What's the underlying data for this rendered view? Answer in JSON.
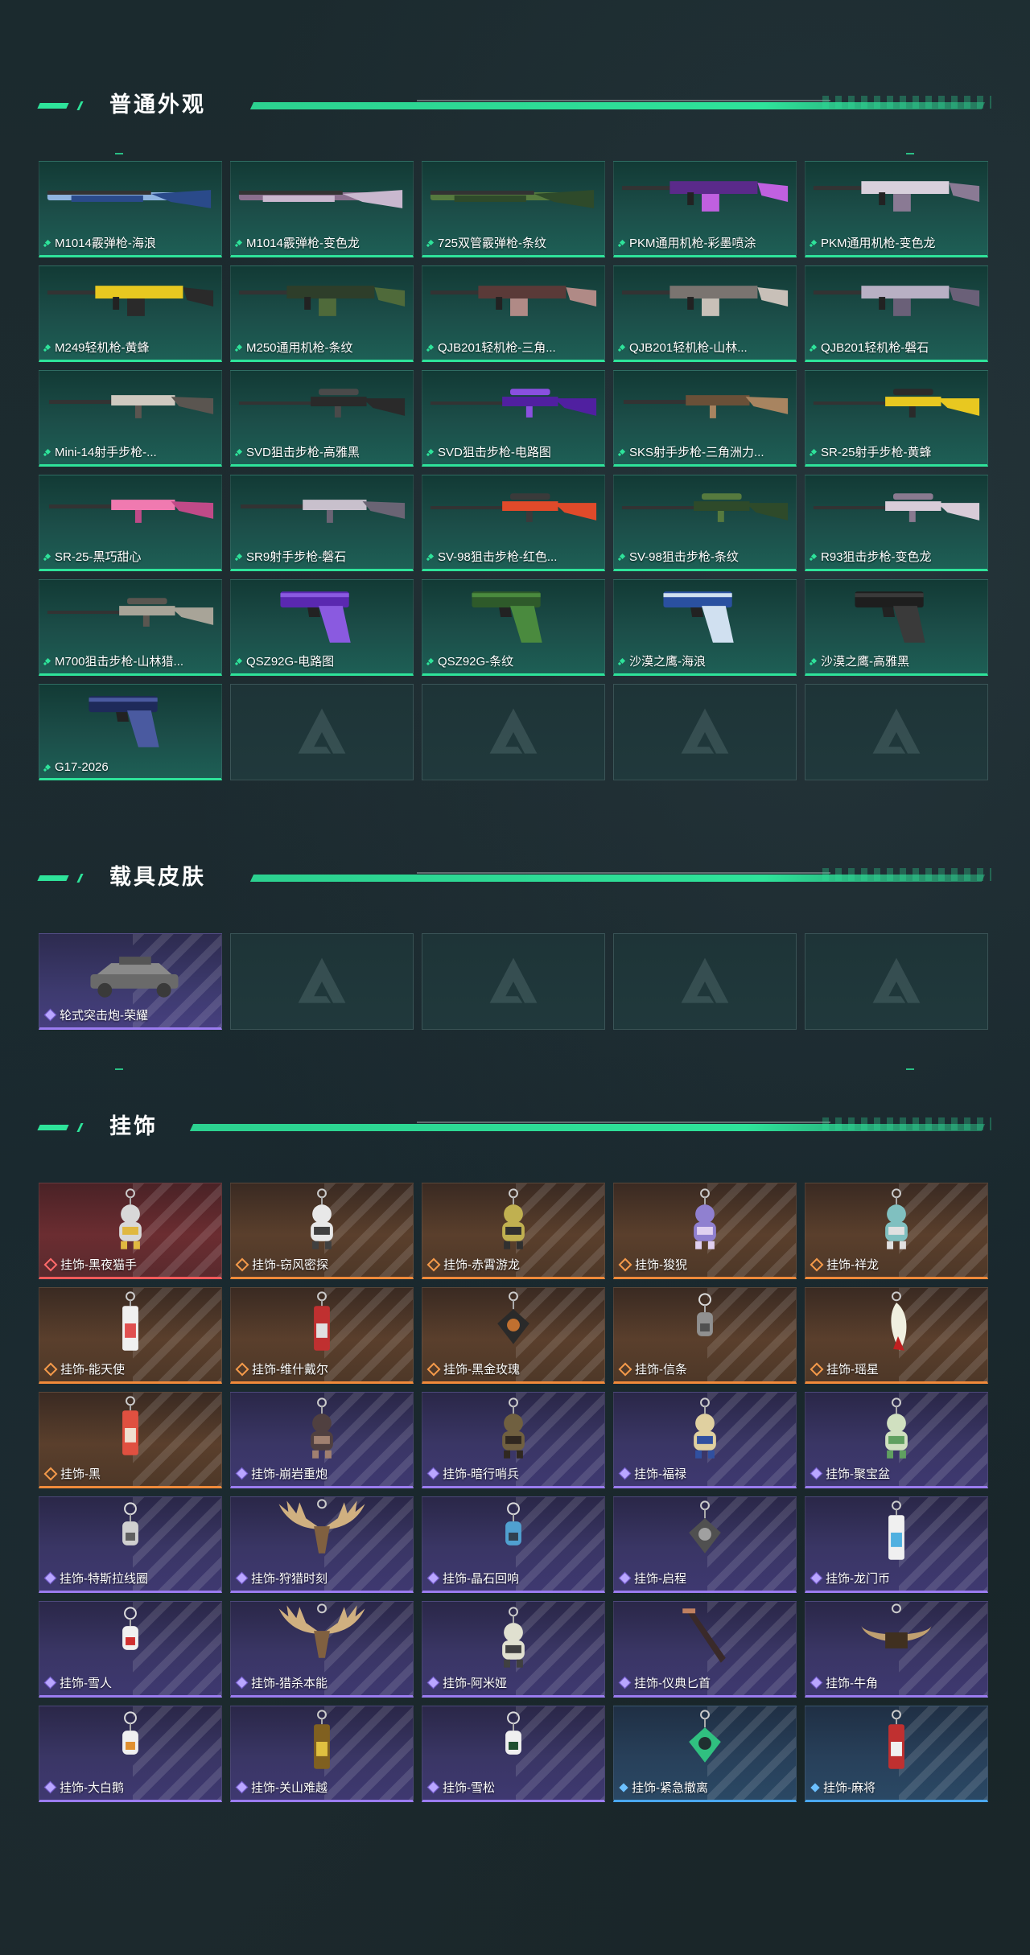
{
  "sections": {
    "skins": {
      "title": "普通外观",
      "items": [
        {
          "name": "M1014霰弹枪-海浪",
          "rarity": "green",
          "art": "shotgun",
          "colors": [
            "#2a4a8a",
            "#8fb4e0"
          ]
        },
        {
          "name": "M1014霰弹枪-变色龙",
          "rarity": "green",
          "art": "shotgun",
          "colors": [
            "#c9b8cf",
            "#8a6f8e"
          ]
        },
        {
          "name": "725双管霰弹枪-条纹",
          "rarity": "green",
          "art": "shotgun",
          "colors": [
            "#2e4a2a",
            "#567a3e"
          ]
        },
        {
          "name": "PKM通用机枪-彩墨喷涂",
          "rarity": "green",
          "art": "mg",
          "colors": [
            "#5a2a8a",
            "#c060e0"
          ]
        },
        {
          "name": "PKM通用机枪-变色龙",
          "rarity": "green",
          "art": "mg",
          "colors": [
            "#d8d0dc",
            "#8a7a94"
          ]
        },
        {
          "name": "M249轻机枪-黄蜂",
          "rarity": "green",
          "art": "mg",
          "colors": [
            "#e8c820",
            "#2a2a2a"
          ]
        },
        {
          "name": "M250通用机枪-条纹",
          "rarity": "green",
          "art": "mg",
          "colors": [
            "#2e3e2a",
            "#4f6a3a"
          ]
        },
        {
          "name": "QJB201轻机枪-三角...",
          "rarity": "green",
          "art": "mg",
          "colors": [
            "#5a3a38",
            "#b08a86"
          ]
        },
        {
          "name": "QJB201轻机枪-山林...",
          "rarity": "green",
          "art": "mg",
          "colors": [
            "#7a7470",
            "#c8c0b8"
          ]
        },
        {
          "name": "QJB201轻机枪-磐石",
          "rarity": "green",
          "art": "mg",
          "colors": [
            "#b8b0c4",
            "#6a6078"
          ]
        },
        {
          "name": "Mini-14射手步枪-...",
          "rarity": "green",
          "art": "rifle",
          "colors": [
            "#cfc9c0",
            "#5a5550"
          ]
        },
        {
          "name": "SVD狙击步枪-高雅黑",
          "rarity": "green",
          "art": "sniper",
          "colors": [
            "#2a2a2a",
            "#4a4a4a"
          ]
        },
        {
          "name": "SVD狙击步枪-电路图",
          "rarity": "green",
          "art": "sniper",
          "colors": [
            "#5020a0",
            "#8a50e0"
          ]
        },
        {
          "name": "SKS射手步枪-三角洲力...",
          "rarity": "green",
          "art": "rifle",
          "colors": [
            "#6a5038",
            "#a88460"
          ]
        },
        {
          "name": "SR-25射手步枪-黄蜂",
          "rarity": "green",
          "art": "sniper",
          "colors": [
            "#e8c820",
            "#2a2a2a"
          ]
        },
        {
          "name": "SR-25-黑巧甜心",
          "rarity": "green",
          "art": "rifle",
          "colors": [
            "#f07ab0",
            "#c04a88"
          ]
        },
        {
          "name": "SR9射手步枪-磐石",
          "rarity": "green",
          "art": "rifle",
          "colors": [
            "#c8c0cc",
            "#6a6474"
          ]
        },
        {
          "name": "SV-98狙击步枪-红色...",
          "rarity": "green",
          "art": "sniper",
          "colors": [
            "#e04a2a",
            "#3a3a3a"
          ]
        },
        {
          "name": "SV-98狙击步枪-条纹",
          "rarity": "green",
          "art": "sniper",
          "colors": [
            "#2e4a2a",
            "#567a3e"
          ]
        },
        {
          "name": "R93狙击步枪-变色龙",
          "rarity": "green",
          "art": "sniper",
          "colors": [
            "#d8ccd8",
            "#8a7a90"
          ]
        },
        {
          "name": "M700狙击步枪-山林猎...",
          "rarity": "green",
          "art": "sniper",
          "colors": [
            "#a8a498",
            "#5a5650"
          ]
        },
        {
          "name": "QSZ92G-电路图",
          "rarity": "green",
          "art": "pistol",
          "colors": [
            "#5a28b0",
            "#8a5ae0"
          ]
        },
        {
          "name": "QSZ92G-条纹",
          "rarity": "green",
          "art": "pistol",
          "colors": [
            "#2e5a2a",
            "#4a8a3e"
          ]
        },
        {
          "name": "沙漠之鹰-海浪",
          "rarity": "green",
          "art": "pistol",
          "colors": [
            "#2a50a0",
            "#d0e0f0"
          ]
        },
        {
          "name": "沙漠之鹰-高雅黑",
          "rarity": "green",
          "art": "pistol",
          "colors": [
            "#1e1e1e",
            "#3a3a3a"
          ]
        },
        {
          "name": "G17-2026",
          "rarity": "green",
          "art": "pistol",
          "colors": [
            "#1e2a5a",
            "#4a5aa0"
          ]
        },
        {
          "name": "",
          "rarity": "empty"
        },
        {
          "name": "",
          "rarity": "empty"
        },
        {
          "name": "",
          "rarity": "empty"
        },
        {
          "name": "",
          "rarity": "empty"
        }
      ]
    },
    "vehicles": {
      "title": "载具皮肤",
      "items": [
        {
          "name": "轮式突击炮-荣耀",
          "rarity": "purple",
          "art": "vehicle",
          "colors": [
            "#8a8a8a",
            "#3a3a3a"
          ]
        },
        {
          "name": "",
          "rarity": "empty"
        },
        {
          "name": "",
          "rarity": "empty"
        },
        {
          "name": "",
          "rarity": "empty"
        },
        {
          "name": "",
          "rarity": "empty"
        }
      ]
    },
    "charms": {
      "title": "挂饰",
      "items": [
        {
          "name": "挂饰-黑夜猫手",
          "rarity": "red",
          "art": "figure",
          "colors": [
            "#d8d8d8",
            "#e0b840"
          ]
        },
        {
          "name": "挂饰-窃风密探",
          "rarity": "orange",
          "art": "figure",
          "colors": [
            "#e8e8e8",
            "#404040"
          ]
        },
        {
          "name": "挂饰-赤霄游龙",
          "rarity": "orange",
          "art": "figure",
          "colors": [
            "#c0b050",
            "#303030"
          ]
        },
        {
          "name": "挂饰-狻猊",
          "rarity": "orange",
          "art": "figure",
          "colors": [
            "#9080d0",
            "#e0d0f0"
          ]
        },
        {
          "name": "挂饰-祥龙",
          "rarity": "orange",
          "art": "figure",
          "colors": [
            "#80c0c0",
            "#e0e0e0"
          ]
        },
        {
          "name": "挂饰-能天使",
          "rarity": "orange",
          "art": "tag",
          "colors": [
            "#e05050",
            "#f0f0f0"
          ]
        },
        {
          "name": "挂饰-维什戴尔",
          "rarity": "orange",
          "art": "tag",
          "colors": [
            "#e0e0e0",
            "#c03030"
          ]
        },
        {
          "name": "挂饰-黑金玫瑰",
          "rarity": "orange",
          "art": "badge",
          "colors": [
            "#2a2a2a",
            "#c07030"
          ]
        },
        {
          "name": "挂饰-信条",
          "rarity": "orange",
          "art": "small",
          "colors": [
            "#909090",
            "#505050"
          ]
        },
        {
          "name": "挂饰-瑶星",
          "rarity": "orange",
          "art": "feather",
          "colors": [
            "#f0f0e0",
            "#c02020"
          ]
        },
        {
          "name": "挂饰-黑",
          "rarity": "orange",
          "art": "tag",
          "colors": [
            "#f0e0d0",
            "#e05040"
          ]
        },
        {
          "name": "挂饰-崩岩重炮",
          "rarity": "purple",
          "art": "figure",
          "colors": [
            "#504040",
            "#a08070"
          ]
        },
        {
          "name": "挂饰-暗行哨兵",
          "rarity": "purple",
          "art": "figure",
          "colors": [
            "#706040",
            "#302820"
          ]
        },
        {
          "name": "挂饰-福禄",
          "rarity": "purple",
          "art": "figure",
          "colors": [
            "#e0d0a0",
            "#3050a0"
          ]
        },
        {
          "name": "挂饰-聚宝盆",
          "rarity": "purple",
          "art": "figure",
          "colors": [
            "#d0e0c0",
            "#60a060"
          ]
        },
        {
          "name": "挂饰-特斯拉线圈",
          "rarity": "purple",
          "art": "small",
          "colors": [
            "#d0d0d0",
            "#606060"
          ]
        },
        {
          "name": "挂饰-狩猎时刻",
          "rarity": "purple",
          "art": "antler",
          "colors": [
            "#d0b080",
            "#806040"
          ]
        },
        {
          "name": "挂饰-晶石回响",
          "rarity": "purple",
          "art": "small",
          "colors": [
            "#50a0d0",
            "#304050"
          ]
        },
        {
          "name": "挂饰-启程",
          "rarity": "purple",
          "art": "badge",
          "colors": [
            "#505050",
            "#a0a0a0"
          ]
        },
        {
          "name": "挂饰-龙门币",
          "rarity": "purple",
          "art": "tag",
          "colors": [
            "#50b0e0",
            "#f0f0f0"
          ]
        },
        {
          "name": "挂饰-雪人",
          "rarity": "purple",
          "art": "small",
          "colors": [
            "#f0f0f0",
            "#d03030"
          ]
        },
        {
          "name": "挂饰-猎杀本能",
          "rarity": "purple",
          "art": "antler",
          "colors": [
            "#d0b080",
            "#806040"
          ]
        },
        {
          "name": "挂饰-阿米娅",
          "rarity": "purple",
          "art": "figure",
          "colors": [
            "#e0e0d0",
            "#404040"
          ]
        },
        {
          "name": "挂饰-仪典匕首",
          "rarity": "purple",
          "art": "dagger",
          "colors": [
            "#3a2a2a",
            "#c08060"
          ]
        },
        {
          "name": "挂饰-牛角",
          "rarity": "purple",
          "art": "horn",
          "colors": [
            "#c0a070",
            "#403020"
          ]
        },
        {
          "name": "挂饰-大白鹅",
          "rarity": "purple",
          "art": "small",
          "colors": [
            "#f0f0f0",
            "#e09030"
          ]
        },
        {
          "name": "挂饰-关山难越",
          "rarity": "purple",
          "art": "tag",
          "colors": [
            "#e0c040",
            "#806020"
          ]
        },
        {
          "name": "挂饰-雪松",
          "rarity": "purple",
          "art": "small",
          "colors": [
            "#f0f0f0",
            "#205030"
          ]
        },
        {
          "name": "挂饰-紧急撤离",
          "rarity": "blue",
          "art": "badge",
          "colors": [
            "#30c080",
            "#203030"
          ]
        },
        {
          "name": "挂饰-麻将",
          "rarity": "blue",
          "art": "tag",
          "colors": [
            "#f0f0f0",
            "#c03030"
          ]
        }
      ]
    }
  }
}
